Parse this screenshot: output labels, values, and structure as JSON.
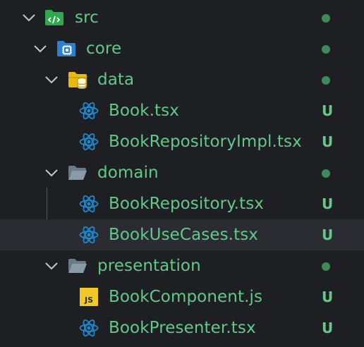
{
  "tree": {
    "rows": [
      {
        "label": "src",
        "status": "",
        "kind": "folder-src",
        "expanded": true
      },
      {
        "label": "core",
        "status": "",
        "kind": "folder-core",
        "expanded": true
      },
      {
        "label": "data",
        "status": "",
        "kind": "folder-data",
        "expanded": true
      },
      {
        "label": "Book.tsx",
        "status": "U",
        "kind": "react-file"
      },
      {
        "label": "BookRepositoryImpl.tsx",
        "status": "U",
        "kind": "react-file"
      },
      {
        "label": "domain",
        "status": "",
        "kind": "folder",
        "expanded": true
      },
      {
        "label": "BookRepository.tsx",
        "status": "U",
        "kind": "react-file"
      },
      {
        "label": "BookUseCases.tsx",
        "status": "U",
        "kind": "react-file",
        "selected": true
      },
      {
        "label": "presentation",
        "status": "",
        "kind": "folder",
        "expanded": true
      },
      {
        "label": "BookComponent.js",
        "status": "U",
        "kind": "js-file"
      },
      {
        "label": "BookPresenter.tsx",
        "status": "U",
        "kind": "react-file"
      }
    ],
    "js_icon_text": "JS"
  },
  "colors": {
    "background": "#1e1f22",
    "selection": "#2a2c31",
    "label_green": "#63c98b",
    "dot_green": "#3e8a5b",
    "react_blue": "#1f8ad2",
    "folder_src_green": "#2fa84f",
    "folder_core_blue": "#2f7fd0",
    "folder_data_yellow": "#e8b90f",
    "folder_plain_gray": "#8a9aa8",
    "js_yellow": "#f0c929"
  }
}
